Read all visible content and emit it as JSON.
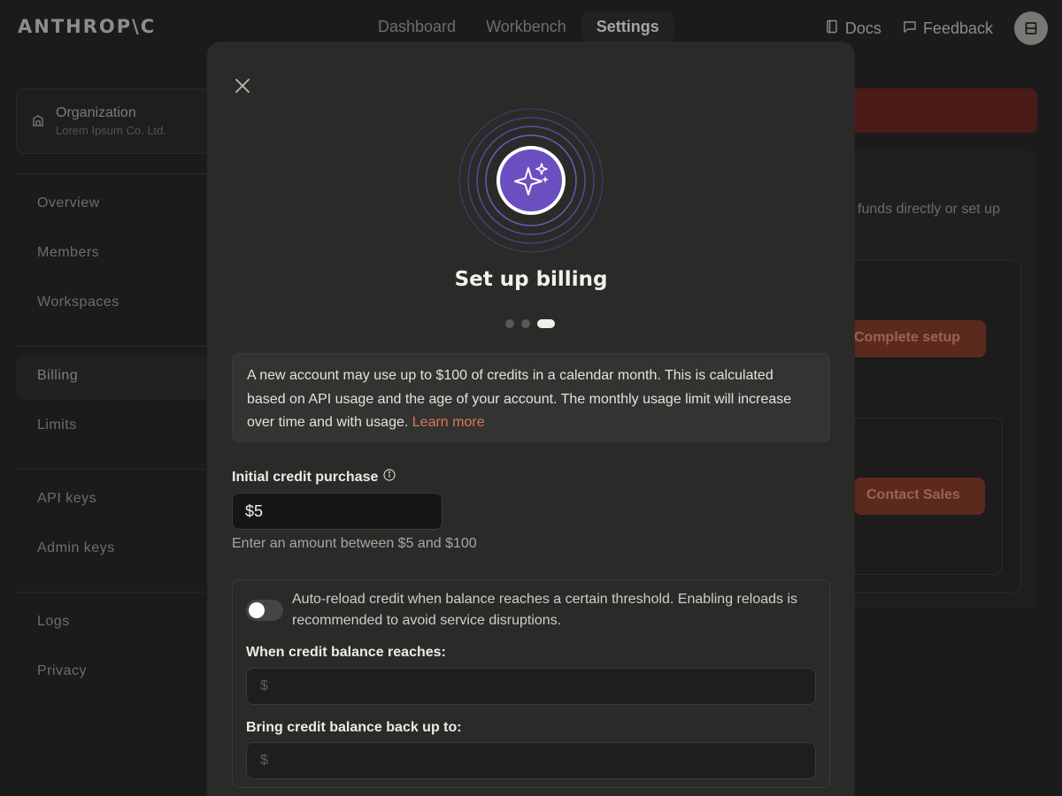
{
  "app": {
    "logo": "ANTHROP\\C",
    "nav": [
      "Dashboard",
      "Workbench",
      "Settings"
    ],
    "nav_active": "Settings",
    "docs_label": "Docs",
    "feedback_label": "Feedback"
  },
  "sidebar": {
    "org_title": "Organization",
    "org_name": "Lorem Ipsum Co. Ltd.",
    "groups": [
      [
        "Overview",
        "Members",
        "Workspaces"
      ],
      [
        "Billing",
        "Limits"
      ],
      [
        "API keys",
        "Admin keys"
      ],
      [
        "Logs",
        "Privacy"
      ]
    ],
    "active": "Billing"
  },
  "background": {
    "partial_text": "funds directly or set up",
    "complete_setup": "Complete setup",
    "contact_sales": "Contact Sales"
  },
  "modal": {
    "title": "Set up billing",
    "steps_total": 3,
    "steps_current": 3,
    "info_text": "A new account may use up to $100 of credits in a calendar month. This is calculated based on API usage and the age of your account. The monthly usage limit will increase over time and with usage. ",
    "learn_more": "Learn more",
    "initial_label": "Initial credit purchase",
    "initial_value": "$5",
    "initial_hint": "Enter an amount between $5 and $100",
    "auto_reload_text": "Auto-reload credit when balance reaches a certain threshold. Enabling reloads is recommended to avoid service disruptions.",
    "auto_reload_enabled": false,
    "threshold_label": "When credit balance reaches:",
    "threshold_placeholder": "$",
    "reload_label": "Bring credit balance back up to:",
    "reload_placeholder": "$"
  },
  "colors": {
    "accent": "#d97757",
    "hero_purple": "#6b4fc0",
    "modal_bg": "#2a2a29"
  }
}
